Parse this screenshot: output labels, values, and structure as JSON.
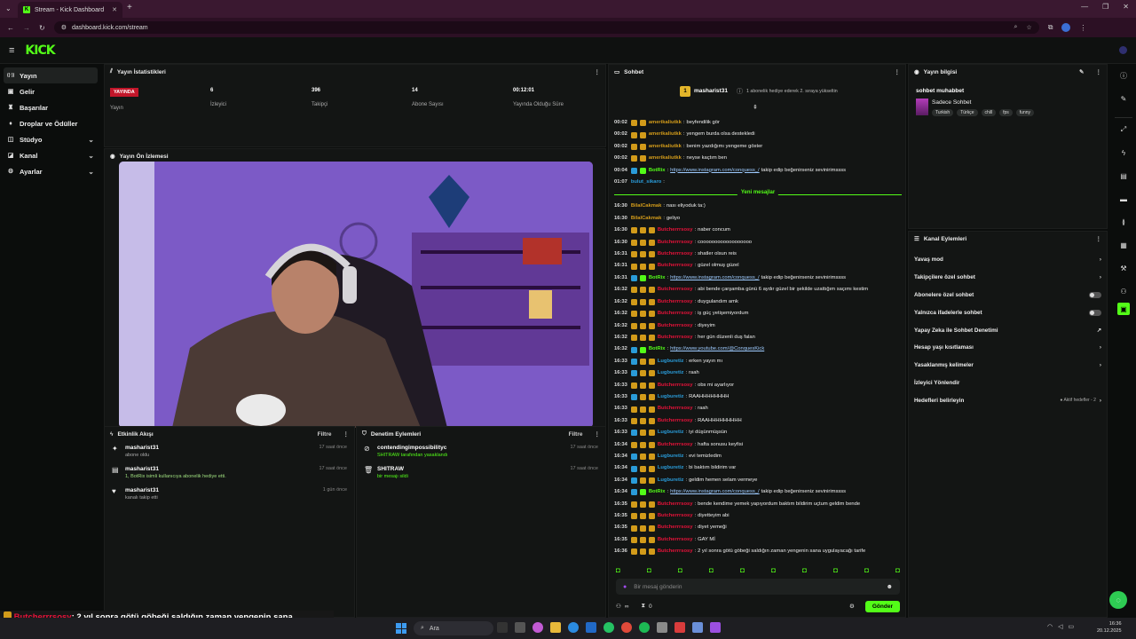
{
  "browser": {
    "tab_title": "Stream - Kick Dashboard",
    "url": "dashboard.kick.com/stream"
  },
  "brand": {
    "logo": "KICK",
    "accent": "#53fc18",
    "beta": "beta"
  },
  "sidebar": [
    {
      "label": "Yayın",
      "icon": "broadcast-icon",
      "active": true
    },
    {
      "label": "Gelir",
      "icon": "wallet-icon"
    },
    {
      "label": "Başarılar",
      "icon": "trophy-icon"
    },
    {
      "label": "Droplar ve Ödüller",
      "icon": "gift-icon"
    },
    {
      "label": "Stüdyo",
      "icon": "studio-icon",
      "chevron": true
    },
    {
      "label": "Kanal",
      "icon": "tag-icon",
      "chevron": true
    },
    {
      "label": "Ayarlar",
      "icon": "gear-icon",
      "chevron": true
    }
  ],
  "stats": {
    "title": "Yayın İstatistikleri",
    "live_badge": "YAYINDA",
    "live_label": "Yayın",
    "items": [
      {
        "value": "6",
        "label": "İzleyici"
      },
      {
        "value": "396",
        "label": "Takipçi"
      },
      {
        "value": "14",
        "label": "Abone Sayısı"
      },
      {
        "value": "00:12:01",
        "label": "Yayında Olduğu Süre"
      }
    ]
  },
  "preview": {
    "title": "Yayın Ön İzlemesi"
  },
  "activity": {
    "title": "Etkinlik Akışı",
    "filter": "Filtre",
    "items": [
      {
        "user": "masharist31",
        "desc": "abone oldu",
        "time": "17 saat önce",
        "icon": "star-icon"
      },
      {
        "user": "masharist31",
        "desc": "1, BotRix isimli kullanıcıya abonelik hediye etti.",
        "time": "17 saat önce",
        "icon": "gift-icon"
      },
      {
        "user": "masharist31",
        "desc": "kanalı takip etti",
        "time": "1 gün önce",
        "icon": "heart-icon"
      }
    ]
  },
  "moderation": {
    "title": "Denetim Eylemleri",
    "filter": "Filtre",
    "items": [
      {
        "user": "contendingimpossibilityc",
        "desc": "SHITRAW tarafından yasaklandı",
        "time": "17 saat önce",
        "icon": "ban-icon"
      },
      {
        "user": "SHITRAW",
        "desc": "bir mesajı sildi",
        "time": "17 saat önce",
        "icon": "trash-icon"
      }
    ]
  },
  "chat": {
    "title": "Sohbet",
    "gift_user": "masharist31",
    "gift_count": "1",
    "gift_text": "1 abonelik hediye ederek 2. sıraya yükseltin",
    "new_messages": "Yeni mesajlar",
    "input_placeholder": "Bir mesaj gönderin",
    "send": "Gönder",
    "count_infinite": "∞",
    "count_zero": "0",
    "messages": [
      {
        "t": "00:02",
        "u": "amerikaliutkk",
        "c": "#d29b1a",
        "m": "beyfendilik gör",
        "b": [
          "y",
          "y"
        ]
      },
      {
        "t": "00:02",
        "u": "amerikaliutkk",
        "c": "#d29b1a",
        "m": "yengem burda olsa destekledi",
        "b": [
          "y",
          "y"
        ]
      },
      {
        "t": "00:02",
        "u": "amerikaliutkk",
        "c": "#d29b1a",
        "m": "benim yazdığımı yengeme göster",
        "b": [
          "y",
          "y"
        ]
      },
      {
        "t": "00:02",
        "u": "amerikaliutkk",
        "c": "#d29b1a",
        "m": "neyse kaçtım ben",
        "b": [
          "y",
          "y"
        ]
      },
      {
        "t": "00:04",
        "u": "BotRix",
        "c": "#53fc18",
        "m": "https://www.instagram.com/conquess_/",
        "m2": " takip edip beğenirseniz sevinirimssss",
        "b": [
          "b",
          "g"
        ]
      },
      {
        "t": "01:07",
        "u": "bulut_sikaro",
        "c": "#2a9bd8",
        "m": "",
        "b": []
      },
      {
        "t": "16:30",
        "u": "BilalCakmak",
        "c": "#d29b1a",
        "m": "nası eliyoduk ta:)",
        "b": []
      },
      {
        "t": "16:30",
        "u": "BilalCakmak",
        "c": "#d29b1a",
        "m": "geliyo",
        "b": []
      },
      {
        "t": "16:30",
        "u": "Butcherrrsosy",
        "c": "#e8123a",
        "m": "naber concum",
        "b": [
          "y",
          "y",
          "y"
        ]
      },
      {
        "t": "16:30",
        "u": "Butcherrrsosy",
        "c": "#e8123a",
        "m": "coooooooooooooooooo",
        "b": [
          "y",
          "y",
          "y"
        ]
      },
      {
        "t": "16:31",
        "u": "Butcherrrsosy",
        "c": "#e8123a",
        "m": "shatler olsun reis",
        "b": [
          "y",
          "y",
          "y"
        ]
      },
      {
        "t": "16:31",
        "u": "Butcherrrsosy",
        "c": "#e8123a",
        "m": "güzel olmuş güzel",
        "b": [
          "y",
          "y",
          "y"
        ]
      },
      {
        "t": "16:31",
        "u": "BotRix",
        "c": "#53fc18",
        "m": "https://www.instagram.com/conquess_/",
        "m2": " takip edip beğenirseniz sevinirimssss",
        "b": [
          "b",
          "g"
        ]
      },
      {
        "t": "16:32",
        "u": "Butcherrrsosy",
        "c": "#e8123a",
        "m": "abi bende çarşamba günü 6 aydır güzel bir şekilde uzattığım saçımı kestim",
        "b": [
          "y",
          "y",
          "y"
        ]
      },
      {
        "t": "16:32",
        "u": "Butcherrrsosy",
        "c": "#e8123a",
        "m": "duygulandım amk",
        "b": [
          "y",
          "y",
          "y"
        ]
      },
      {
        "t": "16:32",
        "u": "Butcherrrsosy",
        "c": "#e8123a",
        "m": "iş güç yetişemiyordum",
        "b": [
          "y",
          "y",
          "y"
        ]
      },
      {
        "t": "16:32",
        "u": "Butcherrrsosy",
        "c": "#e8123a",
        "m": "diyeyim",
        "b": [
          "y",
          "y",
          "y"
        ]
      },
      {
        "t": "16:32",
        "u": "Butcherrrsosy",
        "c": "#e8123a",
        "m": "her gün düzenli duş falan",
        "b": [
          "y",
          "y",
          "y"
        ]
      },
      {
        "t": "16:32",
        "u": "BotRix",
        "c": "#53fc18",
        "m": "https://www.youtube.com/@ConquesKick",
        "m2": "",
        "b": [
          "b",
          "g"
        ]
      },
      {
        "t": "16:33",
        "u": "Lugburetiz",
        "c": "#2a9bd8",
        "m": "erken yayın mı",
        "b": [
          "b",
          "y",
          "y"
        ]
      },
      {
        "t": "16:33",
        "u": "Lugburetiz",
        "c": "#2a9bd8",
        "m": "raah",
        "b": [
          "b",
          "y",
          "y"
        ]
      },
      {
        "t": "16:33",
        "u": "Butcherrrsosy",
        "c": "#e8123a",
        "m": "obs mi ayarlıyor",
        "b": [
          "y",
          "y",
          "y"
        ]
      },
      {
        "t": "16:33",
        "u": "Lugburetiz",
        "c": "#2a9bd8",
        "m": "RAAHHHHHHHH",
        "b": [
          "b",
          "y",
          "y"
        ]
      },
      {
        "t": "16:33",
        "u": "Butcherrrsosy",
        "c": "#e8123a",
        "m": "raah",
        "b": [
          "y",
          "y",
          "y"
        ]
      },
      {
        "t": "16:33",
        "u": "Butcherrrsosy",
        "c": "#e8123a",
        "m": "RAAHHHHHHHHH",
        "b": [
          "y",
          "y",
          "y"
        ]
      },
      {
        "t": "16:33",
        "u": "Lugburetiz",
        "c": "#2a9bd8",
        "m": "iyi düşünmüşsün",
        "b": [
          "b",
          "y",
          "y"
        ]
      },
      {
        "t": "16:34",
        "u": "Butcherrrsosy",
        "c": "#e8123a",
        "m": "hafta sonusu keyfisi",
        "b": [
          "y",
          "y",
          "y"
        ]
      },
      {
        "t": "16:34",
        "u": "Lugburetiz",
        "c": "#2a9bd8",
        "m": "evi temizledim",
        "b": [
          "b",
          "y",
          "y"
        ]
      },
      {
        "t": "16:34",
        "u": "Lugburetiz",
        "c": "#2a9bd8",
        "m": "bi baktım bildirim var",
        "b": [
          "b",
          "y",
          "y"
        ]
      },
      {
        "t": "16:34",
        "u": "Lugburetiz",
        "c": "#2a9bd8",
        "m": "geldim hemen selam vermeye",
        "b": [
          "b",
          "y",
          "y"
        ]
      },
      {
        "t": "16:34",
        "u": "BotRix",
        "c": "#53fc18",
        "m": "https://www.instagram.com/conquess_/",
        "m2": " takip edip beğenirseniz sevinirimssss",
        "b": [
          "b",
          "g"
        ]
      },
      {
        "t": "16:35",
        "u": "Butcherrrsosy",
        "c": "#e8123a",
        "m": "bende kendime yemek yapıyordum baktım bildirim uçtum geldim bende",
        "b": [
          "y",
          "y",
          "y"
        ]
      },
      {
        "t": "16:35",
        "u": "Butcherrrsosy",
        "c": "#e8123a",
        "m": "diyetteyim abi",
        "b": [
          "y",
          "y",
          "y"
        ]
      },
      {
        "t": "16:35",
        "u": "Butcherrrsosy",
        "c": "#e8123a",
        "m": "diyet yemeği",
        "b": [
          "y",
          "y",
          "y"
        ]
      },
      {
        "t": "16:35",
        "u": "Butcherrrsosy",
        "c": "#e8123a",
        "m": "GAY Mİ",
        "b": [
          "y",
          "y",
          "y"
        ]
      },
      {
        "t": "16:36",
        "u": "Butcherrrsosy",
        "c": "#e8123a",
        "m": "2 yıl sonra götü göbeği saldığın zaman yengenin sana uygulayacağı tarife",
        "b": [
          "y",
          "y",
          "y"
        ]
      }
    ]
  },
  "stream_info": {
    "title": "Yayın bilgisi",
    "stream_title": "sohbet muhabbet",
    "category": "Sadece Sohbet",
    "tags": [
      "Turkish",
      "Türkçe",
      "chill",
      "fps",
      "funny"
    ]
  },
  "channel_actions": {
    "title": "Kanal Eylemleri",
    "items": [
      {
        "label": "Yavaş mod",
        "ctrl": "chevron"
      },
      {
        "label": "Takipçilere özel sohbet",
        "ctrl": "chevron"
      },
      {
        "label": "Abonelere özel sohbet",
        "ctrl": "toggle"
      },
      {
        "label": "Yalnızca ifadelerle sohbet",
        "ctrl": "toggle"
      },
      {
        "label": "Yapay Zeka ile Sohbet Denetimi",
        "ctrl": "external"
      },
      {
        "label": "Hesap yaşı kısıtlaması",
        "ctrl": "chevron"
      },
      {
        "label": "Yasaklanmış kelimeler",
        "ctrl": "chevron"
      },
      {
        "label": "İzleyici Yönlendir",
        "ctrl": "none"
      },
      {
        "label": "Hedefleri belirleyin",
        "ctrl": "chevron",
        "extra": "● Aktif hedefler - 2"
      }
    ]
  },
  "overlay": {
    "user": "Butcherrrsosy",
    "text": ": 2 yıl sonra götü göbeği saldığın zaman yengenin sana uygulayacağı tarife"
  },
  "taskbar": {
    "search": "Ara",
    "time": "16:36",
    "date": "20.12.2025"
  }
}
